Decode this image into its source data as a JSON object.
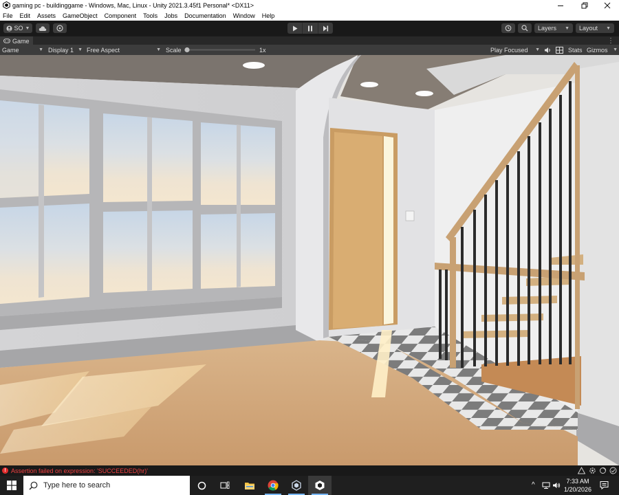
{
  "window": {
    "title": "gaming pc - buildinggame - Windows, Mac, Linux - Unity 2021.3.45f1 Personal* <DX11>",
    "minimize_icon": "minimize-icon",
    "maximize_icon": "restore-icon",
    "close_icon": "close-icon"
  },
  "menu": [
    "File",
    "Edit",
    "Assets",
    "GameObject",
    "Component",
    "Tools",
    "Jobs",
    "Documentation",
    "Window",
    "Help"
  ],
  "toolbar": {
    "account_label": "SO",
    "layers_label": "Layers",
    "layout_label": "Layout"
  },
  "game_tab": {
    "label": "Game",
    "more": "⋮"
  },
  "game_controls": {
    "view_label": "Game",
    "display_label": "Display 1",
    "aspect_label": "Free Aspect",
    "scale_label": "Scale",
    "scale_value": "1x",
    "scale_level": 0,
    "play_mode_label": "Play Focused",
    "stats_label": "Stats",
    "gizmos_label": "Gizmos"
  },
  "status": {
    "message": "Assertion failed on expression: 'SUCCEEDED(hr)'"
  },
  "taskbar": {
    "search_placeholder": "Type here to search",
    "time": "7:33 AM",
    "date": "1/20/2026"
  },
  "colors": {
    "editor_dark": "#191919",
    "panel": "#3c3c3c",
    "error": "#f04040",
    "taskbar_accent": "#78b8ff"
  }
}
